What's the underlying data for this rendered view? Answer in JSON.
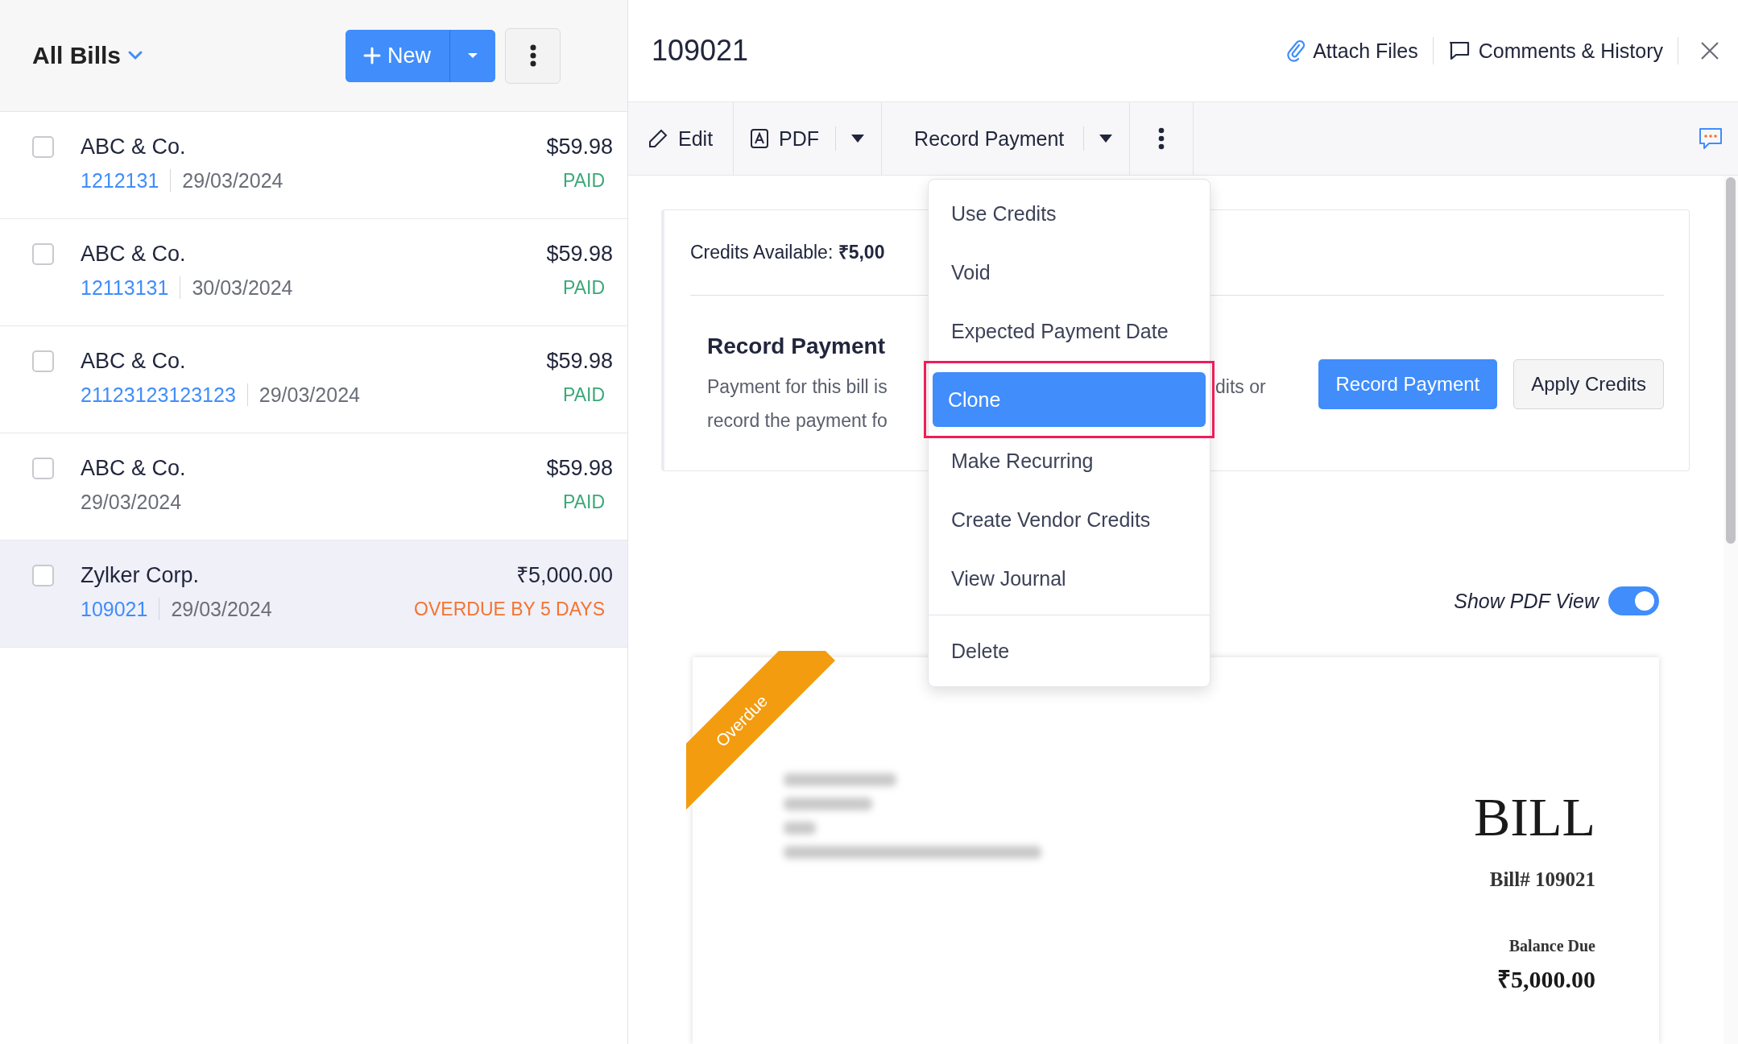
{
  "list_header": {
    "title": "All Bills",
    "new_button": "New"
  },
  "bills": [
    {
      "vendor": "ABC & Co.",
      "number": "1212131",
      "date": "29/03/2024",
      "amount": "$59.98",
      "status": "PAID",
      "kind": "paid",
      "checked": false,
      "selected": false
    },
    {
      "vendor": "ABC & Co.",
      "number": "12113131",
      "date": "30/03/2024",
      "amount": "$59.98",
      "status": "PAID",
      "kind": "paid",
      "checked": false,
      "selected": false
    },
    {
      "vendor": "ABC & Co.",
      "number": "21123123123123",
      "date": "29/03/2024",
      "amount": "$59.98",
      "status": "PAID",
      "kind": "paid",
      "checked": false,
      "selected": false
    },
    {
      "vendor": "ABC & Co.",
      "date": "29/03/2024",
      "amount": "$59.98",
      "status": "PAID",
      "kind": "paid",
      "checked": false,
      "selected": false
    },
    {
      "vendor": "Zylker Corp.",
      "number": "109021",
      "date": "29/03/2024",
      "amount": "₹5,000.00",
      "status": "OVERDUE BY 5 DAYS",
      "kind": "overdue",
      "checked": false,
      "selected": true
    }
  ],
  "detail": {
    "title": "109021",
    "attach_files": "Attach Files",
    "comments": "Comments & History"
  },
  "toolbar": {
    "edit": "Edit",
    "pdf": "PDF",
    "record_payment": "Record Payment"
  },
  "more_menu": {
    "groups": [
      {
        "items": [
          {
            "label": "Use Credits",
            "selected": false
          },
          {
            "label": "Void",
            "selected": false
          },
          {
            "label": "Expected Payment Date",
            "selected": false
          },
          {
            "label": "Clone",
            "selected": true
          },
          {
            "label": "Make Recurring",
            "selected": false
          },
          {
            "label": "Create Vendor Credits",
            "selected": false
          },
          {
            "label": "View Journal",
            "selected": false
          }
        ]
      },
      {
        "items": [
          {
            "label": "Delete",
            "selected": false
          }
        ]
      }
    ]
  },
  "credits": {
    "text": "Credits Available: **₹5,00**"
  },
  "record_payment": {
    "title": "Record Payment",
    "description_lines": [
      "Payment for this bill is",
      "record the payment fo"
    ],
    "description_right": "dits or",
    "primary_button": "Record Payment",
    "secondary_button": "Apply Credits"
  },
  "pdf_view": {
    "label": "Show PDF View",
    "on": true
  },
  "document": {
    "ribbon": "Overdue",
    "heading": "BILL",
    "number": "Bill# 109021",
    "balance_label": "Balance Due",
    "balance": "₹5,000.00"
  }
}
